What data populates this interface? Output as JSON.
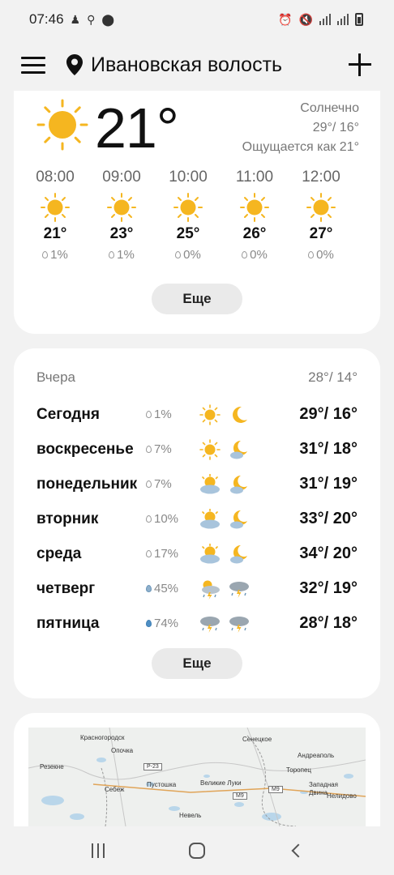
{
  "status_bar": {
    "time": "07:46"
  },
  "app_bar": {
    "location": "Ивановская волость"
  },
  "current": {
    "temp": "21°",
    "condition": "Солнечно",
    "high_low": "29°/ 16°",
    "feels_like": "Ощущается как 21°",
    "icon": "sun-icon"
  },
  "hourly": [
    {
      "time": "08:00",
      "temp": "21°",
      "precip": "1%",
      "icon": "sun-icon"
    },
    {
      "time": "09:00",
      "temp": "23°",
      "precip": "1%",
      "icon": "sun-icon"
    },
    {
      "time": "10:00",
      "temp": "25°",
      "precip": "0%",
      "icon": "sun-icon"
    },
    {
      "time": "11:00",
      "temp": "26°",
      "precip": "0%",
      "icon": "sun-icon"
    },
    {
      "time": "12:00",
      "temp": "27°",
      "precip": "0%",
      "icon": "sun-icon"
    }
  ],
  "more_label": "Еще",
  "forecast": {
    "yesterday_label": "Вчера",
    "yesterday_temps": "28°/ 14°",
    "days": [
      {
        "name": "Сегодня",
        "precip": "1%",
        "day_icon": "sun",
        "night_icon": "moon",
        "temps": "29°/ 16°"
      },
      {
        "name": "воскресенье",
        "precip": "7%",
        "day_icon": "sun",
        "night_icon": "moon-cloud",
        "temps": "31°/ 18°"
      },
      {
        "name": "понедельник",
        "precip": "7%",
        "day_icon": "sun-cloud",
        "night_icon": "moon-cloud",
        "temps": "31°/ 19°"
      },
      {
        "name": "вторник",
        "precip": "10%",
        "day_icon": "sun-cloud",
        "night_icon": "moon-cloud",
        "temps": "33°/ 20°"
      },
      {
        "name": "среда",
        "precip": "17%",
        "day_icon": "sun-cloud",
        "night_icon": "moon-cloud",
        "temps": "34°/ 20°"
      },
      {
        "name": "четверг",
        "precip": "45%",
        "day_icon": "sun-storm",
        "night_icon": "storm",
        "temps": "32°/ 19°"
      },
      {
        "name": "пятница",
        "precip": "74%",
        "day_icon": "storm",
        "night_icon": "storm",
        "temps": "28°/ 18°"
      }
    ]
  },
  "map": {
    "cities": [
      "Красногородск",
      "Опочка",
      "Резекне",
      "Себеж",
      "Пустошка",
      "Великие Луки",
      "Невель",
      "Сенецкое",
      "Андреаполь",
      "Торопец",
      "Западная Двина",
      "Нелидово"
    ],
    "roads": [
      "P-23",
      "M9",
      "M9"
    ]
  }
}
